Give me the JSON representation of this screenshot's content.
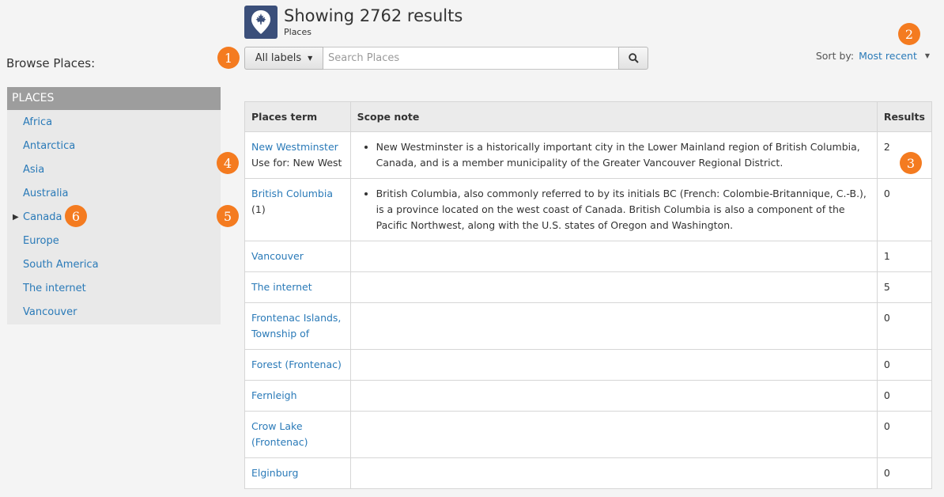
{
  "header": {
    "title": "Showing 2762 results",
    "subtitle": "Places",
    "logo_icon": "maple-leaf-pin-icon"
  },
  "browse": {
    "title": "Browse Places:",
    "section_label": "PLACES",
    "items": [
      {
        "label": "Africa"
      },
      {
        "label": "Antarctica"
      },
      {
        "label": "Asia"
      },
      {
        "label": "Australia"
      },
      {
        "label": "Canada",
        "expandable": true
      },
      {
        "label": "Europe"
      },
      {
        "label": "South America"
      },
      {
        "label": "The internet"
      },
      {
        "label": "Vancouver"
      }
    ]
  },
  "search": {
    "labels_button": "All labels",
    "placeholder": "Search Places",
    "search_icon": "search-icon"
  },
  "sort": {
    "label": "Sort by:",
    "value": "Most recent"
  },
  "table": {
    "headers": [
      "Places term",
      "Scope note",
      "Results"
    ],
    "rows": [
      {
        "term": "New Westminster",
        "extra": "Use for: New West",
        "scope": "New Westminster is a historically important city in the Lower Mainland region of British Columbia, Canada, and is a member municipality of the Greater Vancouver Regional District.",
        "results": "2"
      },
      {
        "term": "British Columbia",
        "extra": "(1)",
        "scope": "British Columbia, also commonly referred to by its initials BC (French: Colombie-Britannique, C.-B.), is a province located on the west coast of Canada. British Columbia is also a component of the Pacific Northwest, along with the U.S. states of Oregon and Washington.",
        "results": "0"
      },
      {
        "term": "Vancouver",
        "extra": "",
        "scope": "",
        "results": "1"
      },
      {
        "term": "The internet",
        "extra": "",
        "scope": "",
        "results": "5"
      },
      {
        "term": "Frontenac Islands, Township of",
        "extra": "",
        "scope": "",
        "results": "0"
      },
      {
        "term": "Forest (Frontenac)",
        "extra": "",
        "scope": "",
        "results": "0"
      },
      {
        "term": "Fernleigh",
        "extra": "",
        "scope": "",
        "results": "0"
      },
      {
        "term": "Crow Lake (Frontenac)",
        "extra": "",
        "scope": "",
        "results": "0"
      },
      {
        "term": "Elginburg",
        "extra": "",
        "scope": "",
        "results": "0"
      }
    ]
  },
  "callouts": [
    "1",
    "2",
    "3",
    "4",
    "5",
    "6"
  ],
  "colors": {
    "accent": "#f47b20",
    "link": "#2a7ab8",
    "logo_bg": "#3b4f7a",
    "sidebar_header": "#9d9d9d"
  }
}
